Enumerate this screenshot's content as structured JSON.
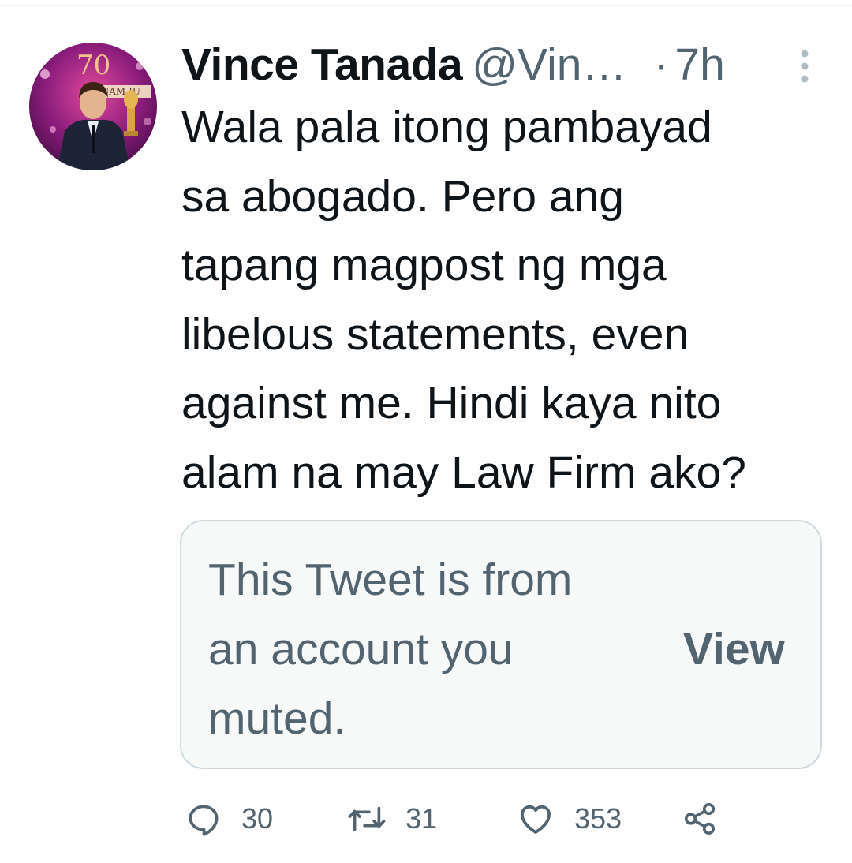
{
  "tweet": {
    "display_name": "Vince Tanada",
    "handle": "@Vin…",
    "separator": "·",
    "time": "7h",
    "avatar": {
      "badge_text": "70",
      "banner_text": "INAM JU"
    },
    "text": "Wala pala itong pambayad\nsa abogado. Pero ang\ntapang magpost ng mga\nlibelous statements, even\nagainst me. Hindi kaya nito\nalam na may Law Firm ako?",
    "muted_card": {
      "message": "This Tweet is from an account you muted.",
      "view_label": "View"
    },
    "actions": {
      "replies": "30",
      "retweets": "31",
      "likes": "353"
    }
  },
  "icons": [
    "more-icon",
    "reply-icon",
    "retweet-icon",
    "like-icon",
    "share-icon"
  ],
  "colors": {
    "text_primary": "#0f1419",
    "text_secondary": "#536471",
    "card_background": "#f7f9f9",
    "card_border": "#cfd9de"
  }
}
